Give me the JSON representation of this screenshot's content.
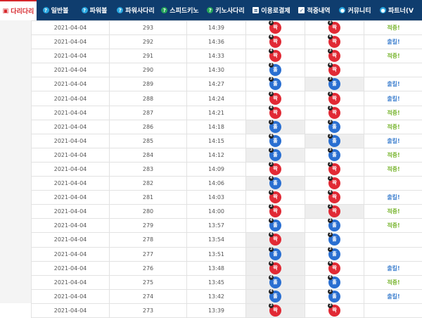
{
  "nav": {
    "items": [
      {
        "label": "다리다리",
        "icon": "ladder-icon"
      },
      {
        "label": "일반볼",
        "icon": "ball-icon"
      },
      {
        "label": "파워볼",
        "icon": "ball-icon"
      },
      {
        "label": "파워사다리",
        "icon": "ball-icon"
      },
      {
        "label": "스피드키노",
        "icon": "keno-icon"
      },
      {
        "label": "키노사다리",
        "icon": "keno-icon"
      },
      {
        "label": "이용로결제",
        "icon": "payment-icon"
      },
      {
        "label": "적중내역",
        "icon": "check-icon"
      },
      {
        "label": "커뮤니티",
        "icon": "community-icon"
      },
      {
        "label": "파트너(V",
        "icon": "partner-icon"
      }
    ]
  },
  "colors": {
    "nav_bg": "#0f3d6e",
    "odd": "#e12a35",
    "even": "#2a6fd1",
    "hit": "#79b530",
    "miss": "#3d7fcf"
  },
  "rows": [
    {
      "date": "2021-04-04",
      "round": "293",
      "time": "14:39",
      "pick1": {
        "label": "짝",
        "lines": "3"
      },
      "pick2": {
        "label": "짝",
        "lines": "3"
      },
      "result": "적중!"
    },
    {
      "date": "2021-04-04",
      "round": "292",
      "time": "14:36",
      "pick1": {
        "label": "짝",
        "lines": "4"
      },
      "pick2": {
        "label": "짝",
        "lines": "4"
      },
      "result": "출킬!"
    },
    {
      "date": "2021-04-04",
      "round": "291",
      "time": "14:33",
      "pick1": {
        "label": "짝",
        "lines": "4"
      },
      "pick2": {
        "label": "짝",
        "lines": "3"
      },
      "result": "적중!"
    },
    {
      "date": "2021-04-04",
      "round": "290",
      "time": "14:30",
      "pick1": {
        "label": "홀",
        "lines": "3"
      },
      "pick2": {
        "label": "짝",
        "lines": "4"
      },
      "result": ""
    },
    {
      "date": "2021-04-04",
      "round": "289",
      "time": "14:27",
      "pick1": {
        "label": "홀",
        "lines": "3"
      },
      "pick2": {
        "label": "홀",
        "lines": "3"
      },
      "result": "출킬!"
    },
    {
      "date": "2021-04-04",
      "round": "288",
      "time": "14:24",
      "pick1": {
        "label": "짝",
        "lines": "3"
      },
      "pick2": {
        "label": "짝",
        "lines": "3"
      },
      "result": "출킬!"
    },
    {
      "date": "2021-04-04",
      "round": "287",
      "time": "14:21",
      "pick1": {
        "label": "짝",
        "lines": "4"
      },
      "pick2": {
        "label": "짝",
        "lines": "3"
      },
      "result": "적중!"
    },
    {
      "date": "2021-04-04",
      "round": "286",
      "time": "14:18",
      "pick1": {
        "label": "홀",
        "lines": "3"
      },
      "pick2": {
        "label": "홀",
        "lines": "3"
      },
      "result": "적중!"
    },
    {
      "date": "2021-04-04",
      "round": "285",
      "time": "14:15",
      "pick1": {
        "label": "홀",
        "lines": "4"
      },
      "pick2": {
        "label": "홀",
        "lines": "3"
      },
      "result": "출킬!"
    },
    {
      "date": "2021-04-04",
      "round": "284",
      "time": "14:12",
      "pick1": {
        "label": "홀",
        "lines": "3"
      },
      "pick2": {
        "label": "홀",
        "lines": "3"
      },
      "result": "적중!"
    },
    {
      "date": "2021-04-04",
      "round": "283",
      "time": "14:09",
      "pick1": {
        "label": "짝",
        "lines": "3"
      },
      "pick2": {
        "label": "짝",
        "lines": "3"
      },
      "result": "적중!"
    },
    {
      "date": "2021-04-04",
      "round": "282",
      "time": "14:06",
      "pick1": {
        "label": "홀",
        "lines": "4"
      },
      "pick2": {
        "label": "짝",
        "lines": "3"
      },
      "result": ""
    },
    {
      "date": "2021-04-04",
      "round": "281",
      "time": "14:03",
      "pick1": {
        "label": "짝",
        "lines": "4"
      },
      "pick2": {
        "label": "짝",
        "lines": "4"
      },
      "result": "출킬!"
    },
    {
      "date": "2021-04-04",
      "round": "280",
      "time": "14:00",
      "pick1": {
        "label": "짝",
        "lines": "3"
      },
      "pick2": {
        "label": "짝",
        "lines": "3"
      },
      "result": "적중!"
    },
    {
      "date": "2021-04-04",
      "round": "279",
      "time": "13:57",
      "pick1": {
        "label": "홀",
        "lines": "4"
      },
      "pick2": {
        "label": "홀",
        "lines": "3"
      },
      "result": "적중!"
    },
    {
      "date": "2021-04-04",
      "round": "278",
      "time": "13:54",
      "pick1": {
        "label": "짝",
        "lines": "4"
      },
      "pick2": {
        "label": "홀",
        "lines": "3"
      },
      "result": ""
    },
    {
      "date": "2021-04-04",
      "round": "277",
      "time": "13:51",
      "pick1": {
        "label": "홀",
        "lines": "3"
      },
      "pick2": {
        "label": "홀",
        "lines": "3"
      },
      "result": ""
    },
    {
      "date": "2021-04-04",
      "round": "276",
      "time": "13:48",
      "pick1": {
        "label": "짝",
        "lines": "4"
      },
      "pick2": {
        "label": "짝",
        "lines": "4"
      },
      "result": "출킬!"
    },
    {
      "date": "2021-04-04",
      "round": "275",
      "time": "13:45",
      "pick1": {
        "label": "홀",
        "lines": "4"
      },
      "pick2": {
        "label": "홀",
        "lines": "4"
      },
      "result": "적중!"
    },
    {
      "date": "2021-04-04",
      "round": "274",
      "time": "13:42",
      "pick1": {
        "label": "홀",
        "lines": "4"
      },
      "pick2": {
        "label": "홀",
        "lines": "3"
      },
      "result": "출킬!"
    },
    {
      "date": "2021-04-04",
      "round": "273",
      "time": "13:39",
      "pick1": {
        "label": "짝",
        "lines": "3"
      },
      "pick2": {
        "label": "짝",
        "lines": "3"
      },
      "result": ""
    }
  ]
}
